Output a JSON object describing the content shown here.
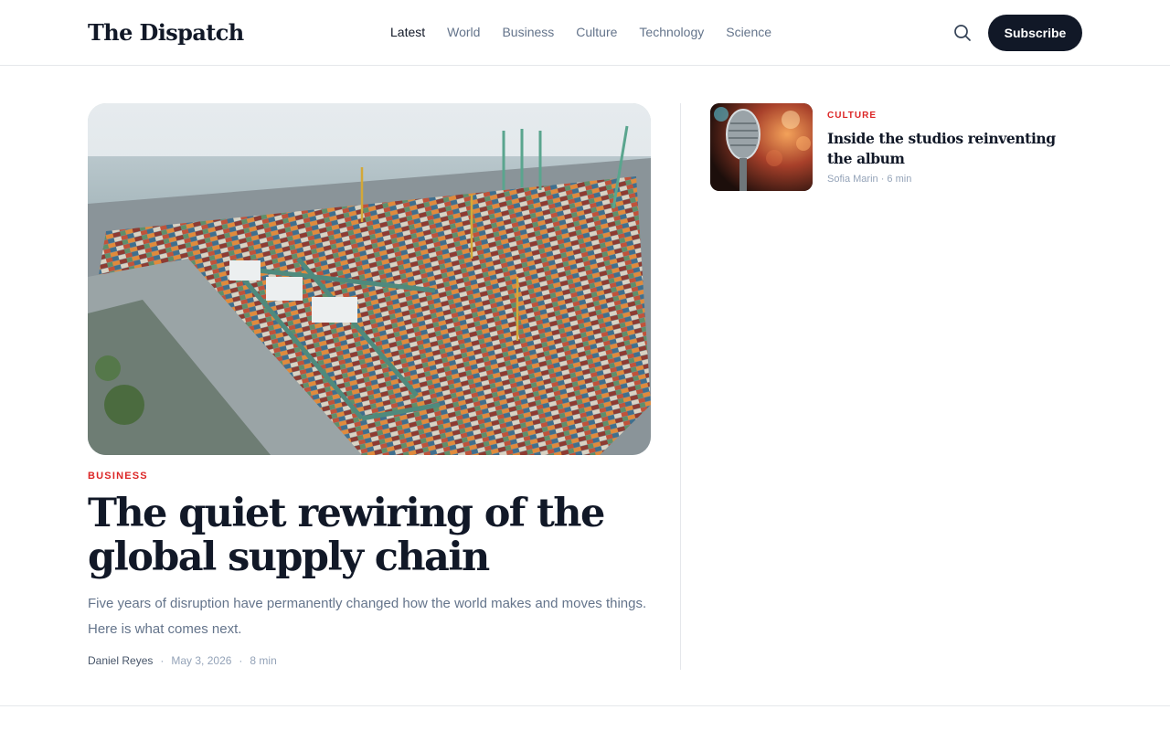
{
  "header": {
    "logo": "The Dispatch",
    "nav": [
      {
        "label": "Latest",
        "active": true
      },
      {
        "label": "World",
        "active": false
      },
      {
        "label": "Business",
        "active": false
      },
      {
        "label": "Culture",
        "active": false
      },
      {
        "label": "Technology",
        "active": false
      },
      {
        "label": "Science",
        "active": false
      }
    ],
    "search_icon": "search-icon",
    "subscribe_label": "Subscribe"
  },
  "hero": {
    "image": "container-port-aerial-photo",
    "kicker": "BUSINESS",
    "title": "The quiet rewiring of the global supply chain",
    "dek": "Five years of disruption have permanently changed how the world makes and moves things. Here is what comes next.",
    "author": "Daniel Reyes",
    "date": "May 3, 2026",
    "read_time": "8 min",
    "separator": "·"
  },
  "side_story": {
    "image": "vintage-microphone-photo",
    "kicker": "CULTURE",
    "title": "Inside the studios reinventing the album",
    "meta": "Sofia Marin · 6 min"
  },
  "colors": {
    "accent": "#dc2626",
    "ink": "#111827",
    "muted": "#64748b",
    "button_bg": "#111827"
  }
}
